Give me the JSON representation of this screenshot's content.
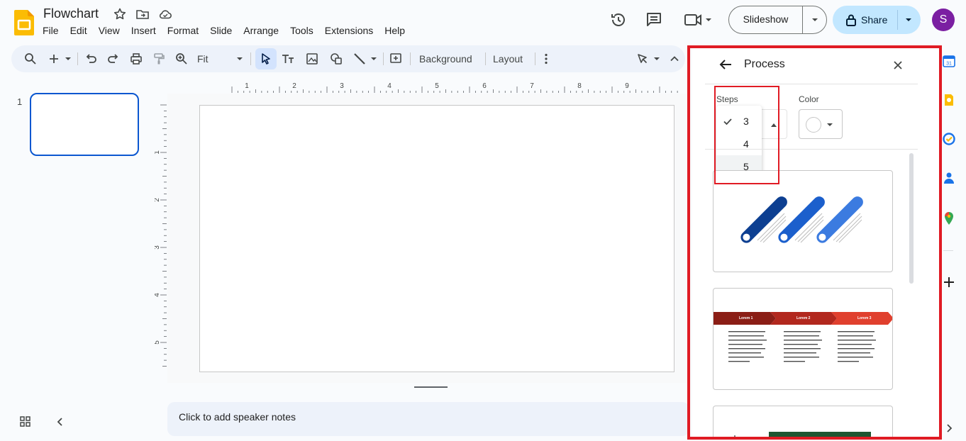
{
  "document": {
    "title": "Flowchart"
  },
  "menu": [
    "File",
    "Edit",
    "View",
    "Insert",
    "Format",
    "Slide",
    "Arrange",
    "Tools",
    "Extensions",
    "Help"
  ],
  "header": {
    "slideshow_label": "Slideshow",
    "share_label": "Share",
    "avatar_initial": "S"
  },
  "toolbar": {
    "zoom_label": "Fit",
    "background_label": "Background",
    "layout_label": "Layout"
  },
  "filmstrip": {
    "slide_number": "1"
  },
  "ruler": {
    "horizontal_ticks": [
      "1",
      "2",
      "3",
      "4",
      "5",
      "6",
      "7",
      "8",
      "9"
    ],
    "vertical_ticks": [
      "1",
      "2",
      "3",
      "4",
      "5"
    ]
  },
  "notes": {
    "placeholder": "Click to add speaker notes"
  },
  "panel": {
    "title": "Process",
    "steps_label": "Steps",
    "color_label": "Color",
    "steps_options": [
      {
        "label": "3",
        "selected": true
      },
      {
        "label": "4",
        "selected": false
      },
      {
        "label": "5",
        "selected": false
      }
    ],
    "template2": {
      "arrows": [
        "Lorem 1",
        "Lorem 2",
        "Lorem 3"
      ],
      "arrow_colors": [
        "#8b1e16",
        "#b2281e",
        "#e0402e"
      ]
    },
    "template1_colors": [
      "#0d3f91",
      "#1b5fcc",
      "#3b7be0"
    ]
  },
  "colors": {
    "accent": "#0b57d0",
    "share_bg": "#c2e7ff",
    "avatar_bg": "#7b1fa2",
    "highlight": "#e01b24"
  },
  "icons": [
    "slides-logo",
    "star-icon",
    "move-folder-icon",
    "cloud-icon",
    "history-icon",
    "comment-icon",
    "video-call-icon",
    "lock-icon",
    "search-icon",
    "plus-icon",
    "undo-icon",
    "redo-icon",
    "print-icon",
    "paint-format-icon",
    "zoom-icon",
    "select-icon",
    "text-box-icon",
    "image-icon",
    "shape-icon",
    "line-icon",
    "add-comment-icon",
    "more-icon",
    "pen-icon",
    "collapse-icon",
    "back-arrow-icon",
    "close-icon",
    "check-icon",
    "grid-view-icon",
    "chevron-left-icon",
    "calendar-icon",
    "keep-icon",
    "tasks-icon",
    "contacts-icon",
    "maps-icon",
    "add-icon"
  ]
}
